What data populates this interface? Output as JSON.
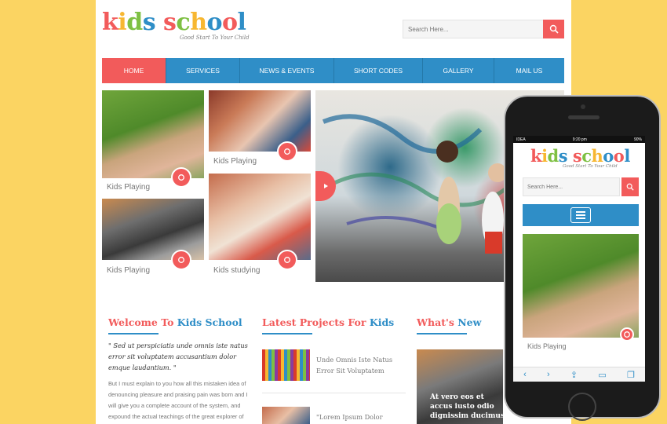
{
  "brand": {
    "letters": [
      "k",
      "i",
      "d",
      "s",
      " ",
      "s",
      "c",
      "h",
      "o",
      "o",
      "l"
    ],
    "letter_colors": [
      "#f25b5b",
      "#f7b731",
      "#7ec043",
      "#2f8ec7",
      "#ffffff",
      "#f25b5b",
      "#7ec043",
      "#f7b731",
      "#2f8ec7",
      "#f25b5b",
      "#2f8ec7"
    ],
    "tagline": "Good Start To Your Child"
  },
  "search": {
    "placeholder": "Search Here..."
  },
  "nav": {
    "items": [
      "HOME",
      "SERVICES",
      "NEWS & EVENTS",
      "SHORT CODES",
      "GALLERY",
      "MAIL US"
    ],
    "active": "HOME"
  },
  "gallery": {
    "captions": [
      "Kids Playing",
      "Kids Playing",
      "Kids Playing",
      "Kids studying"
    ]
  },
  "welcome": {
    "title_red": "Welcome To",
    "title_blue": "Kids School",
    "quote": "\" Sed ut perspiciatis unde omnis iste natus error sit voluptatem accusantium dolor emque laudantium. \"",
    "body": "But I must explain to you how all this mistaken idea of denouncing pleasure and praising pain was born and I will give you a complete account of the system, and expound the actual teachings of the great explorer of the truth, the"
  },
  "projects": {
    "title_red": "Latest Projects For",
    "title_blue": "Kids",
    "items": [
      "Unde Omnis Iste Natus Error Sit Voluptatem",
      "\"Lorem Ipsum Dolor"
    ]
  },
  "whats_new": {
    "title_red": "What's",
    "title_blue": "New",
    "text": "At vero eos et accus iusto odio dignissim ducimus"
  },
  "phone": {
    "carrier": "IDEA",
    "time": "9:20 pm",
    "battery": "90%",
    "search_placeholder": "Search Here...",
    "caption": "Kids Playing",
    "toolbar": [
      "‹",
      "›",
      "⇪",
      "▭",
      "❐"
    ]
  },
  "colors": {
    "accent_red": "#f25b5b",
    "accent_blue": "#2f8ec7",
    "background": "#fbd462"
  }
}
